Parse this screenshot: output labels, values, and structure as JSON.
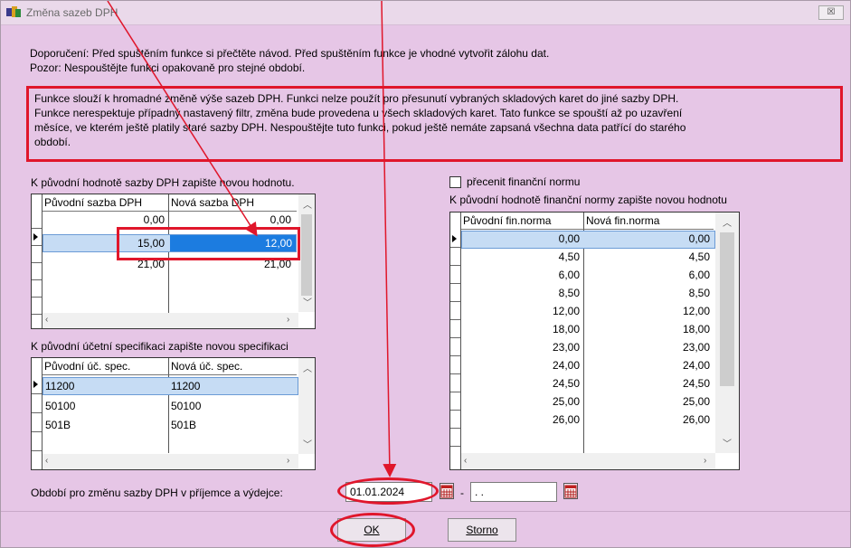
{
  "window": {
    "title": "Změna sazeb DPH",
    "close_label": "☒"
  },
  "notes": {
    "line1": "Doporučení: Před spuštěním funkce si přečtěte návod. Před spuštěním funkce je vhodné vytvořit zálohu dat.",
    "line2": "Pozor: Nespouštějte funkci opakovaně pro stejné období."
  },
  "info": {
    "line1": "Funkce slouží k hromadné změně výše sazeb DPH. Funkci nelze použít pro přesunutí vybraných skladových karet do jiné sazby DPH.",
    "line2": "Funkce nerespektuje případný nastavený filtr, změna bude provedena u všech skladových karet. Tato funkce se spouští až po uzavření",
    "line3": "měsíce, ve kterém ještě platily staré sazby DPH. Nespouštějte tuto funkci, pokud ještě nemáte zapsaná všechna data patřící do starého",
    "line4": "období."
  },
  "vat_grid": {
    "label": "K původní  hodnotě sazby DPH zapište novou hodnotu.",
    "col1": "Původní sazba DPH",
    "col2": "Nová sazba DPH",
    "rows": [
      {
        "old": "0,00",
        "new": "0,00"
      },
      {
        "old": "15,00",
        "new": "12,00"
      },
      {
        "old": "21,00",
        "new": "21,00"
      }
    ]
  },
  "spec_grid": {
    "label": "K původní  účetní specifikaci zapište novou specifikaci",
    "col1": "Původní úč. spec.",
    "col2": "Nová úč. spec.",
    "rows": [
      {
        "old": "11200",
        "new": "11200"
      },
      {
        "old": "50100",
        "new": "50100"
      },
      {
        "old": "501B",
        "new": "501B"
      }
    ]
  },
  "norm_grid": {
    "checkbox_label": "přecenit finanční normu",
    "label": "K původní  hodnotě finanční normy zapište novou hodnotu",
    "col1": "Původní fin.norma",
    "col2": "Nová fin.norma",
    "rows": [
      {
        "old": "0,00",
        "new": "0,00"
      },
      {
        "old": "4,50",
        "new": "4,50"
      },
      {
        "old": "6,00",
        "new": "6,00"
      },
      {
        "old": "8,50",
        "new": "8,50"
      },
      {
        "old": "12,00",
        "new": "12,00"
      },
      {
        "old": "18,00",
        "new": "18,00"
      },
      {
        "old": "23,00",
        "new": "23,00"
      },
      {
        "old": "24,00",
        "new": "24,00"
      },
      {
        "old": "24,50",
        "new": "24,50"
      },
      {
        "old": "25,00",
        "new": "25,00"
      },
      {
        "old": "26,00",
        "new": "26,00"
      }
    ]
  },
  "period": {
    "label": "Období pro změnu sazby DPH v příjemce a výdejce:",
    "from": "01.01.2024",
    "separator": "-",
    "to": " .  ."
  },
  "buttons": {
    "ok_label": "OK",
    "cancel_label": "Storno"
  },
  "colors": {
    "accent_red": "#e0162b",
    "window_bg": "#e6c6e6",
    "selection_blue": "#1c7ce0",
    "selected_row": "#c6dcf4"
  }
}
